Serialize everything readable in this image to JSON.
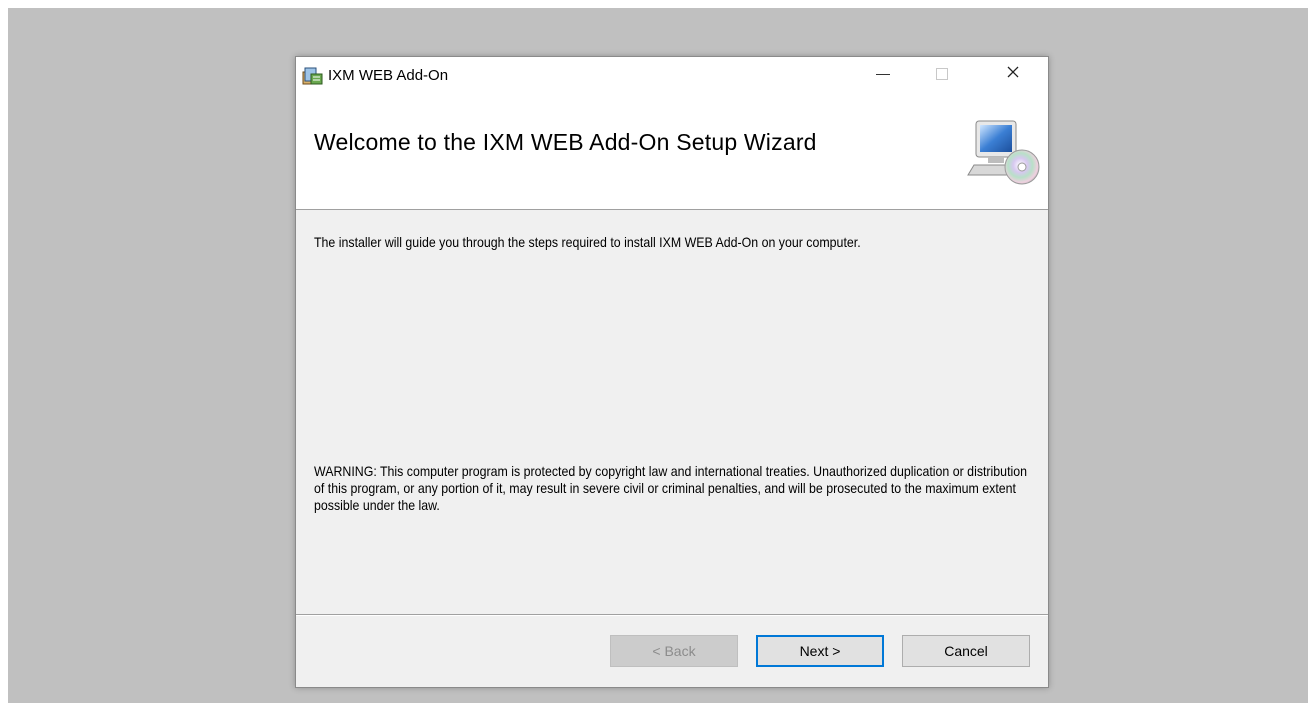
{
  "window": {
    "title": "IXM WEB Add-On",
    "controls": {
      "close_glyph": "✕"
    }
  },
  "header": {
    "title": "Welcome to the IXM WEB Add-On Setup Wizard",
    "icon": "computer-cd-icon"
  },
  "body": {
    "intro": "The installer will guide you through the steps required to install IXM WEB Add-On on your computer.",
    "warning": "WARNING: This computer program is protected by copyright law and international treaties. Unauthorized duplication or distribution of this program, or any portion of it, may result in severe civil or criminal penalties, and will be prosecuted to the maximum extent possible under the law."
  },
  "buttons": {
    "back": "< Back",
    "next": "Next >",
    "cancel": "Cancel"
  },
  "colors": {
    "desktop": "#c0c0c0",
    "window_bg": "#f0f0f0",
    "header_bg": "#ffffff",
    "accent": "#0078d7"
  }
}
